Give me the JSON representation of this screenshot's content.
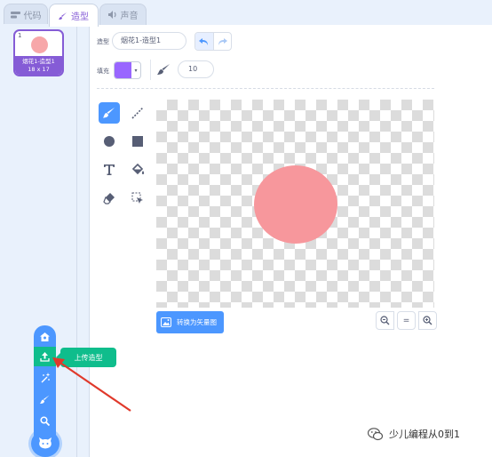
{
  "tabs": [
    {
      "label": "代码",
      "icon": "code-icon"
    },
    {
      "label": "造型",
      "icon": "brush-icon"
    },
    {
      "label": "声音",
      "icon": "speaker-icon"
    }
  ],
  "costume_list": {
    "items": [
      {
        "number": "1",
        "name": "烟花1-造型1",
        "size": "18 x 17",
        "selected": true
      }
    ]
  },
  "editor": {
    "costume_label": "造型",
    "costume_name": "烟花1-造型1",
    "fill_label": "填充",
    "fill_color": "#9966ff",
    "brush_size": "10",
    "convert_button_label": "转换为矢量图",
    "zoom": {
      "out": "−",
      "reset": "=",
      "in": "+"
    }
  },
  "tools": [
    "brush",
    "line",
    "circle",
    "rectangle",
    "text",
    "fill",
    "eraser",
    "select"
  ],
  "sprite_fill_color": "#f7979c",
  "add_costume_menu": {
    "items": [
      "paint-icon",
      "upload-icon",
      "surprise-icon",
      "brush-icon",
      "search-icon"
    ],
    "tooltip": "上传造型"
  },
  "watermark": "少儿编程从0到1",
  "colors": {
    "accent": "#855cd6",
    "blue": "#4c97ff",
    "green": "#0fbd8c"
  }
}
